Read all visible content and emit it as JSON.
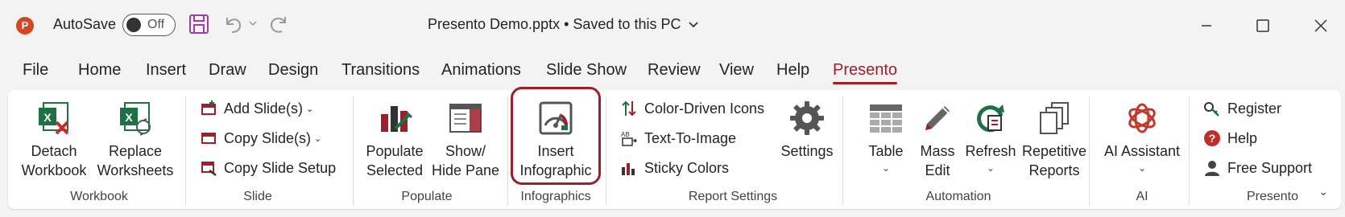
{
  "titlebar": {
    "app_logo": "P",
    "autosave_label": "AutoSave",
    "autosave_state": "Off",
    "document_title": "Presento Demo.pptx • Saved to this PC",
    "icons": [
      "save-icon",
      "undo-icon",
      "redo-icon",
      "minimize-icon",
      "maximize-icon",
      "close-icon"
    ]
  },
  "tabs": [
    {
      "label": "File"
    },
    {
      "label": "Home"
    },
    {
      "label": "Insert"
    },
    {
      "label": "Draw"
    },
    {
      "label": "Design"
    },
    {
      "label": "Transitions"
    },
    {
      "label": "Animations"
    },
    {
      "label": "Slide Show"
    },
    {
      "label": "Review"
    },
    {
      "label": "View"
    },
    {
      "label": "Help"
    },
    {
      "label": "Presento",
      "active": true
    }
  ],
  "groups": {
    "workbook": {
      "label": "Workbook",
      "detach": {
        "line1": "Detach",
        "line2": "Workbook"
      },
      "replace": {
        "line1": "Replace",
        "line2": "Worksheets"
      }
    },
    "slide": {
      "label": "Slide",
      "add": "Add Slide(s)",
      "copy": "Copy Slide(s)",
      "setup": "Copy Slide Setup"
    },
    "populate": {
      "label": "Populate",
      "populate_selected": {
        "line1": "Populate",
        "line2": "Selected"
      },
      "show_hide": {
        "line1": "Show/",
        "line2": "Hide Pane"
      }
    },
    "infographics": {
      "label": "Infographics",
      "insert": {
        "line1": "Insert",
        "line2": "Infographic"
      }
    },
    "report_settings": {
      "label": "Report Settings",
      "color_icons": "Color-Driven Icons",
      "text_to_image": "Text-To-Image",
      "sticky_colors": "Sticky Colors",
      "settings": "Settings"
    },
    "automation": {
      "label": "Automation",
      "table": "Table",
      "mass_edit": {
        "line1": "Mass",
        "line2": "Edit"
      },
      "refresh": "Refresh",
      "repetitive": {
        "line1": "Repetitive",
        "line2": "Reports"
      }
    },
    "ai": {
      "label": "AI",
      "assistant": "AI Assistant"
    },
    "presento": {
      "label": "Presento",
      "register": "Register",
      "help": "Help",
      "support": "Free Support"
    }
  },
  "colors": {
    "accent": "#9e1f2a",
    "excel_green": "#1e7145",
    "ribbon_bg": "#ffffff",
    "window_bg": "#f3f3f3"
  }
}
